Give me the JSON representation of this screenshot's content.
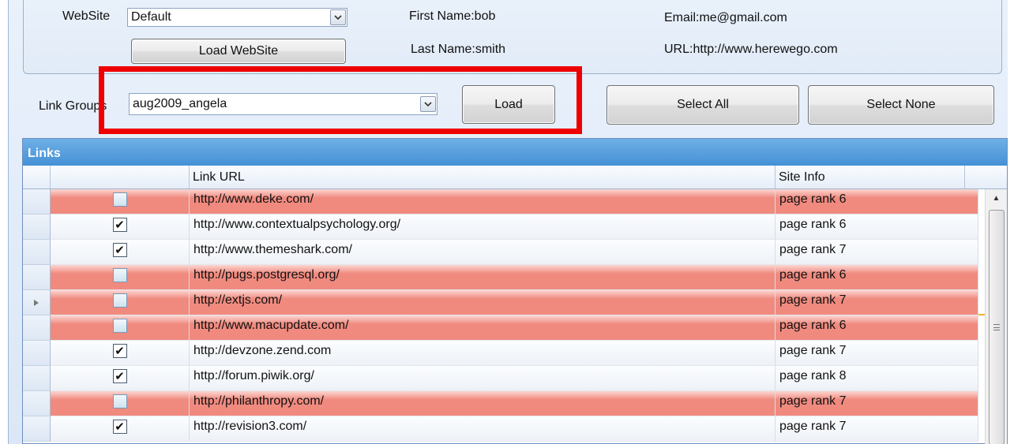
{
  "website": {
    "label": "WebSite",
    "selected": "Default",
    "load_button": "Load WebSite",
    "first_name": "First Name:bob",
    "last_name": "Last Name:smith",
    "email": "Email:me@gmail.com",
    "url": "URL:http://www.herewego.com"
  },
  "link_groups": {
    "label": "Link Groups",
    "selected": "aug2009_angela",
    "load_button": "Load",
    "select_all": "Select All",
    "select_none": "Select None"
  },
  "colors": {
    "highlight": "#ee0000",
    "unchecked_row": "#f08a7f",
    "header_blue": "#4590d6"
  },
  "links": {
    "title": "Links",
    "columns": [
      "",
      "Link URL",
      "Site Info"
    ],
    "rows": [
      {
        "checked": false,
        "url": "http://www.deke.com/",
        "info": "page rank 6"
      },
      {
        "checked": true,
        "url": "http://www.contextualpsychology.org/",
        "info": "page rank 6"
      },
      {
        "checked": true,
        "url": "http://www.themeshark.com/",
        "info": "page rank 7"
      },
      {
        "checked": false,
        "url": "http://pugs.postgresql.org/",
        "info": "page rank 6"
      },
      {
        "checked": false,
        "url": "http://extjs.com/",
        "info": "page rank 7",
        "current": true
      },
      {
        "checked": false,
        "url": "http://www.macupdate.com/",
        "info": "page rank 6"
      },
      {
        "checked": true,
        "url": "http://devzone.zend.com",
        "info": "page rank 7"
      },
      {
        "checked": true,
        "url": "http://forum.piwik.org/",
        "info": "page rank 8"
      },
      {
        "checked": false,
        "url": "http://philanthropy.com/",
        "info": "page rank 7"
      },
      {
        "checked": true,
        "url": "http://revision3.com/",
        "info": "page rank 7"
      }
    ]
  }
}
